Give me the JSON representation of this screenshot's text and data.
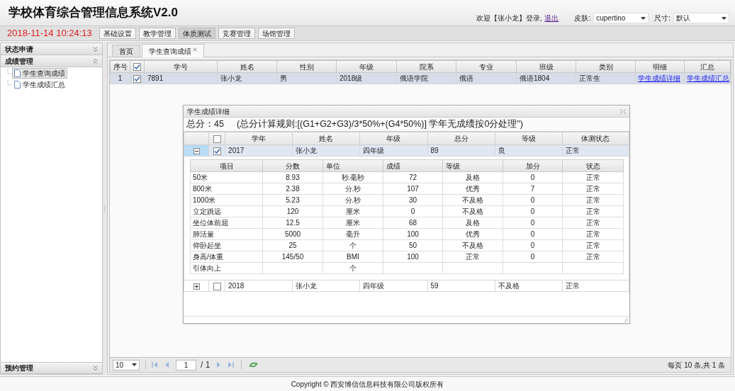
{
  "app_title": "学校体育综合管理信息系统V2.0",
  "welcome": {
    "text": "欢迎【张小龙】登录,",
    "logout": "退出"
  },
  "skin": {
    "label": "皮肤:",
    "value": "cupertino"
  },
  "size": {
    "label": "尺寸:",
    "value": "默认"
  },
  "datetime": "2018-11-14 10:24:13",
  "top_menu": [
    {
      "label": "基础设置",
      "selected": false
    },
    {
      "label": "教学管理",
      "selected": false
    },
    {
      "label": "体质测试",
      "selected": true
    },
    {
      "label": "竞赛管理",
      "selected": false
    },
    {
      "label": "场馆管理",
      "selected": false
    }
  ],
  "sidebar": {
    "sections": [
      {
        "title": "状态申请",
        "expanded": false
      },
      {
        "title": "成绩管理",
        "expanded": true,
        "items": [
          {
            "label": "学生查询成绩",
            "selected": true
          },
          {
            "label": "学生成绩汇总",
            "selected": false
          }
        ]
      }
    ],
    "bottom_section": {
      "title": "预约管理",
      "expanded": false
    }
  },
  "tabs": [
    {
      "label": "首页",
      "selected": false,
      "closable": false
    },
    {
      "label": "学生查询成绩",
      "selected": true,
      "closable": true
    }
  ],
  "table": {
    "header_checked": true,
    "columns": [
      "序号",
      "学号",
      "姓名",
      "性别",
      "年级",
      "院系",
      "专业",
      "班级",
      "类别",
      "明细",
      "汇总"
    ],
    "rows": [
      {
        "checked": true,
        "selected": true,
        "cells": [
          "1",
          "7891",
          "张小龙",
          "男",
          "2018级",
          "俄语学院",
          "俄语",
          "俄语1804",
          "正常生"
        ],
        "links": [
          "学生成绩详细",
          "学生成绩汇总"
        ]
      }
    ]
  },
  "pager": {
    "page_size": "10",
    "page": "1",
    "total_pages": "/ 1",
    "summary": "每页 10 条,共 1 条"
  },
  "dialog": {
    "title": "学生成绩详细",
    "total_label": "总分：",
    "total": "45",
    "rule": "(总分计算规则:[(G1+G2+G3)/3*50%+(G4*50%)] 学年无成绩按0分处理\")",
    "header_checked": false,
    "columns": [
      "学年",
      "姓名",
      "年级",
      "总分",
      "等级",
      "体测状态"
    ],
    "rows": [
      {
        "expanded": true,
        "checked": true,
        "selected": true,
        "cells": [
          "2017",
          "张小龙",
          "四年级",
          "89",
          "良",
          "正常"
        ],
        "detail": {
          "columns": [
            "项目",
            "分数",
            "单位",
            "成绩",
            "等级",
            "加分",
            "状态"
          ],
          "rows": [
            [
              "50米",
              "8.93",
              "秒.毫秒",
              "72",
              "及格",
              "0",
              "正常"
            ],
            [
              "800米",
              "2.38",
              "分.秒",
              "107",
              "优秀",
              "7",
              "正常"
            ],
            [
              "1000米",
              "5.23",
              "分.秒",
              "30",
              "不及格",
              "0",
              "正常"
            ],
            [
              "立定跳远",
              "120",
              "厘米",
              "0",
              "不及格",
              "0",
              "正常"
            ],
            [
              "坐位体前屈",
              "12.5",
              "厘米",
              "68",
              "及格",
              "0",
              "正常"
            ],
            [
              "肺活量",
              "5000",
              "毫升",
              "100",
              "优秀",
              "0",
              "正常"
            ],
            [
              "仰卧起坐",
              "25",
              "个",
              "50",
              "不及格",
              "0",
              "正常"
            ],
            [
              "身高/体重",
              "145/50",
              "BMI",
              "100",
              "正常",
              "0",
              "正常"
            ],
            [
              "引体向上",
              "",
              "个",
              "",
              "",
              "",
              ""
            ]
          ]
        }
      },
      {
        "expanded": false,
        "checked": false,
        "selected": false,
        "cells": [
          "2018",
          "张小龙",
          "四年级",
          "59",
          "不及格",
          "正常"
        ]
      }
    ]
  },
  "footer": "Copyright © 西安博信信息科技有限公司版权所有"
}
